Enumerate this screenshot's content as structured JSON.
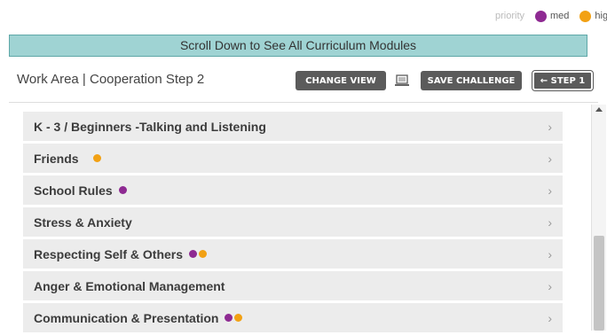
{
  "legend": {
    "label": "priority",
    "items": [
      {
        "label": "med",
        "color": "#8e2a92"
      },
      {
        "label": "high",
        "color": "#f2a114"
      }
    ]
  },
  "banner": {
    "text": "Scroll Down to See All Curriculum Modules"
  },
  "toolbar": {
    "title": "Work Area | Cooperation Step 2",
    "change_view_label": "CHANGE VIEW",
    "laptop_icon": "laptop-icon",
    "save_challenge_label": "SAVE CHALLENGE",
    "step1_label": "← STEP 1"
  },
  "colors": {
    "med": "#8e2a92",
    "high": "#f2a114",
    "banner": "#9fd3d3",
    "button": "#5b5b5b",
    "row": "#ececec"
  },
  "modules": [
    {
      "name": "K - 3 / Beginners -Talking and Listening",
      "priorities": [],
      "chevron": "›"
    },
    {
      "name": "Friends",
      "priorities": [
        "high"
      ],
      "chevron": "›"
    },
    {
      "name": "School Rules",
      "priorities": [
        "med"
      ],
      "chevron": "›"
    },
    {
      "name": "Stress & Anxiety",
      "priorities": [],
      "chevron": "›"
    },
    {
      "name": "Respecting Self & Others",
      "priorities": [
        "med",
        "high"
      ],
      "chevron": "›"
    },
    {
      "name": "Anger & Emotional Management",
      "priorities": [],
      "chevron": "›"
    },
    {
      "name": "Communication & Presentation",
      "priorities": [
        "med",
        "high"
      ],
      "chevron": "›"
    }
  ]
}
